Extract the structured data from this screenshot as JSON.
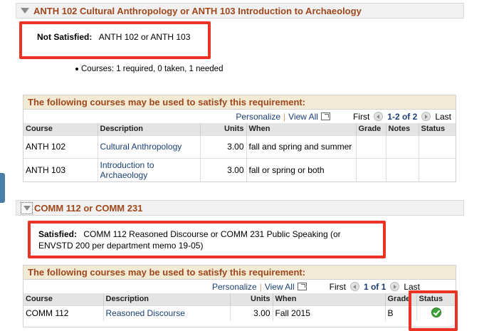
{
  "section1": {
    "title": "ANTH 102 Cultural Anthropology or ANTH 103 Introduction to Archaeology",
    "status_label": "Not Satisfied:",
    "status_text": "ANTH 102 or ANTH 103",
    "courses_line": "Courses: 1 required, 0 taken, 1 needed",
    "grid": {
      "title": "The following courses may be used to satisfy this requirement:",
      "personalize": "Personalize",
      "view_all": "View All",
      "first": "First",
      "range": "1-2 of 2",
      "last": "Last",
      "columns": [
        "Course",
        "Description",
        "Units",
        "When",
        "Grade",
        "Notes",
        "Status"
      ],
      "rows": [
        {
          "course": "ANTH 102",
          "description": "Cultural Anthropology",
          "units": "3.00",
          "when": "fall and spring and summer",
          "grade": "",
          "notes": "",
          "status": ""
        },
        {
          "course": "ANTH 103",
          "description": "Introduction to Archaeology",
          "units": "3.00",
          "when": "fall or spring or both",
          "grade": "",
          "notes": "",
          "status": ""
        }
      ]
    }
  },
  "section2": {
    "title": "COMM 112 or COMM 231",
    "status_label": "Satisfied:",
    "status_text": "COMM 112 Reasoned Discourse or COMM 231 Public Speaking (or ENVSTD 200 per department memo 19-05)",
    "grid": {
      "title": "The following courses may be used to satisfy this requirement:",
      "personalize": "Personalize",
      "view_all": "View All",
      "first": "First",
      "range": "1 of 1",
      "last": "Last",
      "columns": [
        "Course",
        "Description",
        "Units",
        "When",
        "Grade",
        "Status"
      ],
      "rows": [
        {
          "course": "COMM 112",
          "description": "Reasoned Discourse",
          "units": "3.00",
          "when": "Fall 2015",
          "grade": "B",
          "status_icon": "check-circle-icon"
        }
      ]
    }
  },
  "colors": {
    "accent": "#a0471b",
    "link": "#1a3f75",
    "highlight": "#ea3323",
    "success": "#3fa33a"
  }
}
